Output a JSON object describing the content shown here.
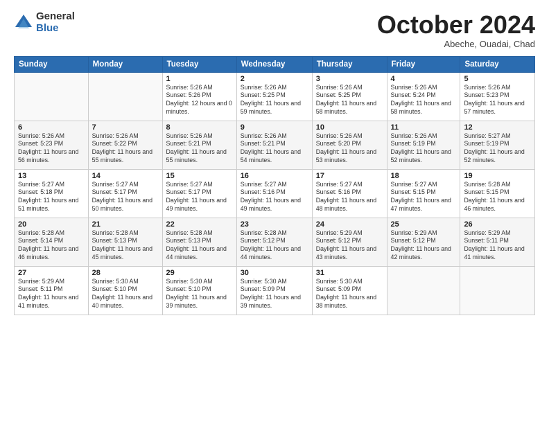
{
  "header": {
    "logo_general": "General",
    "logo_blue": "Blue",
    "month_title": "October 2024",
    "subtitle": "Abeche, Ouadai, Chad"
  },
  "weekdays": [
    "Sunday",
    "Monday",
    "Tuesday",
    "Wednesday",
    "Thursday",
    "Friday",
    "Saturday"
  ],
  "weeks": [
    [
      {
        "day": "",
        "info": ""
      },
      {
        "day": "",
        "info": ""
      },
      {
        "day": "1",
        "info": "Sunrise: 5:26 AM\nSunset: 5:26 PM\nDaylight: 12 hours\nand 0 minutes."
      },
      {
        "day": "2",
        "info": "Sunrise: 5:26 AM\nSunset: 5:25 PM\nDaylight: 11 hours\nand 59 minutes."
      },
      {
        "day": "3",
        "info": "Sunrise: 5:26 AM\nSunset: 5:25 PM\nDaylight: 11 hours\nand 58 minutes."
      },
      {
        "day": "4",
        "info": "Sunrise: 5:26 AM\nSunset: 5:24 PM\nDaylight: 11 hours\nand 58 minutes."
      },
      {
        "day": "5",
        "info": "Sunrise: 5:26 AM\nSunset: 5:23 PM\nDaylight: 11 hours\nand 57 minutes."
      }
    ],
    [
      {
        "day": "6",
        "info": "Sunrise: 5:26 AM\nSunset: 5:23 PM\nDaylight: 11 hours\nand 56 minutes."
      },
      {
        "day": "7",
        "info": "Sunrise: 5:26 AM\nSunset: 5:22 PM\nDaylight: 11 hours\nand 55 minutes."
      },
      {
        "day": "8",
        "info": "Sunrise: 5:26 AM\nSunset: 5:21 PM\nDaylight: 11 hours\nand 55 minutes."
      },
      {
        "day": "9",
        "info": "Sunrise: 5:26 AM\nSunset: 5:21 PM\nDaylight: 11 hours\nand 54 minutes."
      },
      {
        "day": "10",
        "info": "Sunrise: 5:26 AM\nSunset: 5:20 PM\nDaylight: 11 hours\nand 53 minutes."
      },
      {
        "day": "11",
        "info": "Sunrise: 5:26 AM\nSunset: 5:19 PM\nDaylight: 11 hours\nand 52 minutes."
      },
      {
        "day": "12",
        "info": "Sunrise: 5:27 AM\nSunset: 5:19 PM\nDaylight: 11 hours\nand 52 minutes."
      }
    ],
    [
      {
        "day": "13",
        "info": "Sunrise: 5:27 AM\nSunset: 5:18 PM\nDaylight: 11 hours\nand 51 minutes."
      },
      {
        "day": "14",
        "info": "Sunrise: 5:27 AM\nSunset: 5:17 PM\nDaylight: 11 hours\nand 50 minutes."
      },
      {
        "day": "15",
        "info": "Sunrise: 5:27 AM\nSunset: 5:17 PM\nDaylight: 11 hours\nand 49 minutes."
      },
      {
        "day": "16",
        "info": "Sunrise: 5:27 AM\nSunset: 5:16 PM\nDaylight: 11 hours\nand 49 minutes."
      },
      {
        "day": "17",
        "info": "Sunrise: 5:27 AM\nSunset: 5:16 PM\nDaylight: 11 hours\nand 48 minutes."
      },
      {
        "day": "18",
        "info": "Sunrise: 5:27 AM\nSunset: 5:15 PM\nDaylight: 11 hours\nand 47 minutes."
      },
      {
        "day": "19",
        "info": "Sunrise: 5:28 AM\nSunset: 5:15 PM\nDaylight: 11 hours\nand 46 minutes."
      }
    ],
    [
      {
        "day": "20",
        "info": "Sunrise: 5:28 AM\nSunset: 5:14 PM\nDaylight: 11 hours\nand 46 minutes."
      },
      {
        "day": "21",
        "info": "Sunrise: 5:28 AM\nSunset: 5:13 PM\nDaylight: 11 hours\nand 45 minutes."
      },
      {
        "day": "22",
        "info": "Sunrise: 5:28 AM\nSunset: 5:13 PM\nDaylight: 11 hours\nand 44 minutes."
      },
      {
        "day": "23",
        "info": "Sunrise: 5:28 AM\nSunset: 5:12 PM\nDaylight: 11 hours\nand 44 minutes."
      },
      {
        "day": "24",
        "info": "Sunrise: 5:29 AM\nSunset: 5:12 PM\nDaylight: 11 hours\nand 43 minutes."
      },
      {
        "day": "25",
        "info": "Sunrise: 5:29 AM\nSunset: 5:12 PM\nDaylight: 11 hours\nand 42 minutes."
      },
      {
        "day": "26",
        "info": "Sunrise: 5:29 AM\nSunset: 5:11 PM\nDaylight: 11 hours\nand 41 minutes."
      }
    ],
    [
      {
        "day": "27",
        "info": "Sunrise: 5:29 AM\nSunset: 5:11 PM\nDaylight: 11 hours\nand 41 minutes."
      },
      {
        "day": "28",
        "info": "Sunrise: 5:30 AM\nSunset: 5:10 PM\nDaylight: 11 hours\nand 40 minutes."
      },
      {
        "day": "29",
        "info": "Sunrise: 5:30 AM\nSunset: 5:10 PM\nDaylight: 11 hours\nand 39 minutes."
      },
      {
        "day": "30",
        "info": "Sunrise: 5:30 AM\nSunset: 5:09 PM\nDaylight: 11 hours\nand 39 minutes."
      },
      {
        "day": "31",
        "info": "Sunrise: 5:30 AM\nSunset: 5:09 PM\nDaylight: 11 hours\nand 38 minutes."
      },
      {
        "day": "",
        "info": ""
      },
      {
        "day": "",
        "info": ""
      }
    ]
  ]
}
